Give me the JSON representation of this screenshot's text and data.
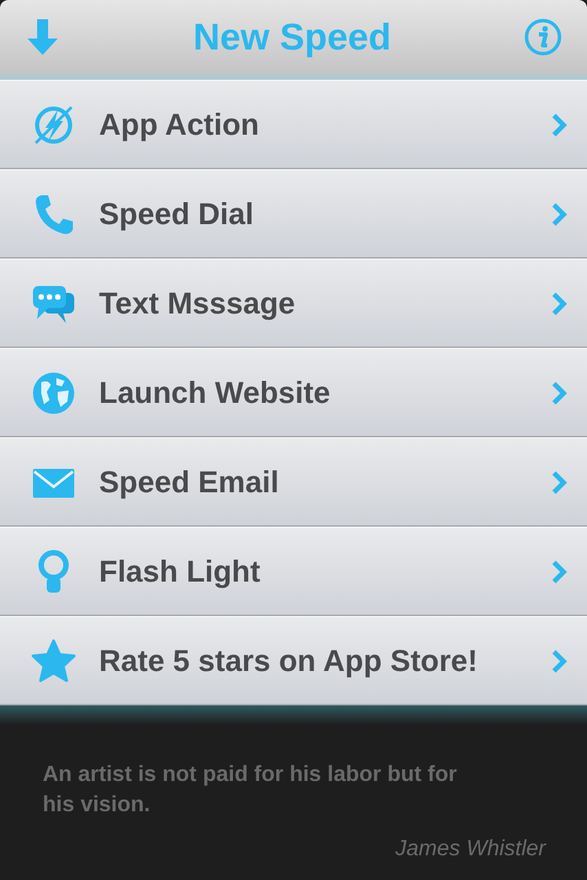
{
  "header": {
    "title": "New Speed"
  },
  "items": [
    {
      "kind": "action",
      "label": "App Action"
    },
    {
      "kind": "dial",
      "label": "Speed Dial"
    },
    {
      "kind": "message",
      "label": "Text Msssage"
    },
    {
      "kind": "website",
      "label": "Launch Website"
    },
    {
      "kind": "email",
      "label": "Speed Email"
    },
    {
      "kind": "light",
      "label": "Flash Light"
    },
    {
      "kind": "rate",
      "label": "Rate 5 stars on App Store!"
    }
  ],
  "quote": {
    "text": "An artist is not paid for his labor but for his vision.",
    "author": "James Whistler"
  }
}
